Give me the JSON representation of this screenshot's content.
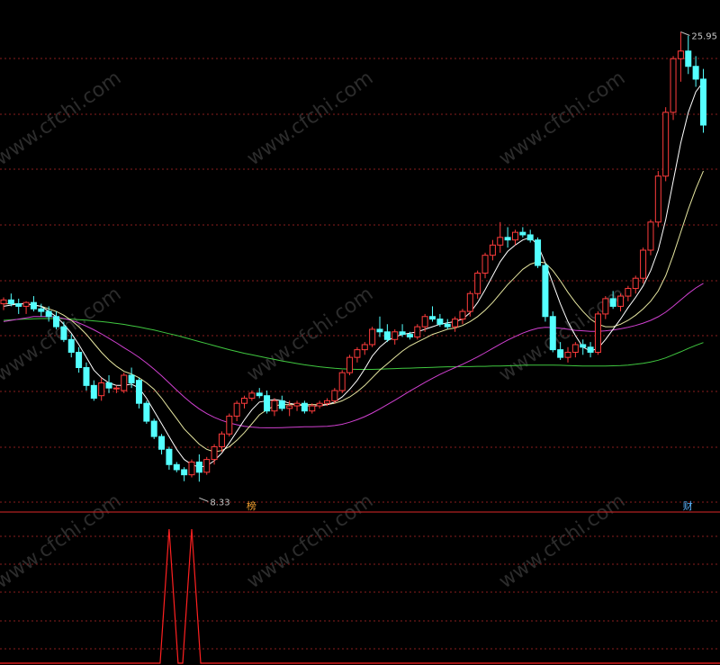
{
  "chart_data": {
    "type": "candlestick",
    "panels": 2,
    "ylim": [
      7.6,
      27.2
    ],
    "grid": true,
    "max_label": "25.95",
    "min_label": "8.33",
    "max_value": 25.95,
    "min_value": 8.33,
    "signal_markers": [
      {
        "label": "榜",
        "bar_index": 33,
        "color": "#f0a030"
      },
      {
        "label": "财",
        "bar_index": 91,
        "color": "#5ab4ff"
      }
    ],
    "watermark_text": "www.cfchi.com",
    "colors": {
      "up": "#ff3c3c",
      "down": "#54ffff",
      "ma_short": "#ffffff",
      "ma_mid": "#e6e6a0",
      "ma_long": "#d040d0",
      "ma_longest": "#40c840",
      "grid": "#8a1e1e",
      "signal": "#ff2020"
    },
    "candles": [
      [
        15.3,
        15.55,
        15.05,
        15.45
      ],
      [
        15.45,
        15.7,
        15.2,
        15.3
      ],
      [
        15.3,
        15.5,
        14.9,
        15.2
      ],
      [
        15.2,
        15.4,
        14.9,
        15.35
      ],
      [
        15.35,
        15.6,
        15.0,
        15.1
      ],
      [
        15.1,
        15.3,
        14.8,
        15.0
      ],
      [
        15.0,
        15.2,
        14.6,
        14.8
      ],
      [
        14.8,
        15.0,
        14.3,
        14.4
      ],
      [
        14.4,
        14.6,
        13.8,
        13.9
      ],
      [
        13.9,
        14.1,
        13.2,
        13.4
      ],
      [
        13.4,
        13.6,
        12.6,
        12.8
      ],
      [
        12.8,
        13.0,
        11.9,
        12.1
      ],
      [
        12.1,
        12.3,
        11.5,
        11.6
      ],
      [
        11.7,
        12.4,
        11.5,
        12.2
      ],
      [
        12.2,
        12.5,
        11.8,
        12.0
      ],
      [
        12.0,
        12.1,
        11.8,
        12.0
      ],
      [
        11.9,
        12.6,
        11.8,
        12.5
      ],
      [
        12.5,
        12.8,
        12.0,
        12.2
      ],
      [
        12.3,
        12.4,
        11.2,
        11.4
      ],
      [
        11.4,
        11.5,
        10.6,
        10.7
      ],
      [
        10.7,
        10.8,
        10.0,
        10.1
      ],
      [
        10.1,
        10.2,
        9.4,
        9.6
      ],
      [
        9.6,
        9.7,
        8.8,
        9.0
      ],
      [
        9.0,
        9.1,
        8.7,
        8.8
      ],
      [
        8.8,
        8.9,
        8.35,
        8.6
      ],
      [
        8.6,
        9.2,
        8.5,
        9.1
      ],
      [
        9.1,
        9.4,
        8.33,
        8.7
      ],
      [
        8.7,
        9.3,
        8.6,
        9.2
      ],
      [
        9.2,
        9.8,
        9.0,
        9.7
      ],
      [
        9.7,
        10.3,
        9.5,
        10.2
      ],
      [
        10.2,
        11.0,
        10.1,
        10.9
      ],
      [
        10.9,
        11.5,
        10.7,
        11.4
      ],
      [
        11.4,
        11.7,
        11.2,
        11.6
      ],
      [
        11.6,
        11.9,
        11.5,
        11.8
      ],
      [
        11.8,
        12.0,
        11.6,
        11.7
      ],
      [
        11.7,
        11.9,
        11.0,
        11.1
      ],
      [
        11.1,
        11.6,
        10.9,
        11.5
      ],
      [
        11.5,
        11.7,
        11.1,
        11.2
      ],
      [
        11.2,
        11.5,
        10.9,
        11.3
      ],
      [
        11.3,
        11.5,
        11.1,
        11.4
      ],
      [
        11.4,
        11.5,
        11.0,
        11.1
      ],
      [
        11.1,
        11.4,
        11.0,
        11.3
      ],
      [
        11.3,
        11.5,
        11.2,
        11.4
      ],
      [
        11.4,
        11.6,
        11.3,
        11.5
      ],
      [
        11.5,
        12.0,
        11.4,
        11.9
      ],
      [
        11.9,
        12.7,
        11.8,
        12.6
      ],
      [
        12.6,
        13.3,
        12.5,
        13.2
      ],
      [
        13.2,
        13.6,
        13.0,
        13.5
      ],
      [
        13.5,
        13.8,
        13.3,
        13.7
      ],
      [
        13.7,
        14.4,
        13.6,
        14.3
      ],
      [
        14.3,
        14.8,
        14.0,
        14.2
      ],
      [
        14.2,
        14.5,
        13.8,
        13.9
      ],
      [
        13.9,
        14.3,
        13.7,
        14.2
      ],
      [
        14.2,
        14.5,
        14.0,
        14.1
      ],
      [
        14.1,
        14.2,
        13.9,
        14.0
      ],
      [
        14.0,
        14.5,
        13.9,
        14.4
      ],
      [
        14.4,
        14.9,
        14.2,
        14.8
      ],
      [
        14.8,
        15.2,
        14.6,
        14.7
      ],
      [
        14.7,
        14.9,
        14.4,
        14.5
      ],
      [
        14.5,
        14.7,
        14.3,
        14.4
      ],
      [
        14.4,
        14.8,
        14.2,
        14.7
      ],
      [
        14.7,
        15.1,
        14.5,
        15.0
      ],
      [
        15.0,
        15.8,
        14.8,
        15.7
      ],
      [
        15.7,
        16.6,
        15.5,
        16.5
      ],
      [
        16.5,
        17.3,
        16.3,
        17.2
      ],
      [
        17.2,
        17.8,
        17.0,
        17.6
      ],
      [
        17.6,
        18.5,
        17.3,
        17.9
      ],
      [
        17.9,
        18.3,
        17.5,
        17.8
      ],
      [
        17.8,
        18.2,
        17.6,
        18.1
      ],
      [
        18.1,
        18.3,
        17.9,
        18.0
      ],
      [
        18.0,
        18.2,
        17.7,
        17.8
      ],
      [
        17.8,
        17.9,
        16.7,
        16.8
      ],
      [
        16.8,
        16.9,
        14.6,
        14.8
      ],
      [
        14.8,
        15.0,
        13.4,
        13.5
      ],
      [
        13.5,
        13.8,
        13.1,
        13.2
      ],
      [
        13.2,
        13.6,
        13.0,
        13.4
      ],
      [
        13.4,
        13.8,
        13.2,
        13.7
      ],
      [
        13.7,
        13.9,
        13.3,
        13.6
      ],
      [
        13.6,
        13.8,
        13.2,
        13.4
      ],
      [
        13.4,
        15.0,
        13.3,
        14.9
      ],
      [
        14.9,
        15.6,
        14.7,
        15.5
      ],
      [
        15.5,
        15.8,
        15.1,
        15.2
      ],
      [
        15.2,
        15.7,
        15.0,
        15.6
      ],
      [
        15.6,
        16.0,
        15.4,
        15.9
      ],
      [
        15.9,
        16.4,
        15.7,
        16.3
      ],
      [
        16.3,
        17.5,
        16.1,
        17.4
      ],
      [
        17.4,
        18.6,
        17.2,
        18.5
      ],
      [
        18.5,
        20.5,
        18.3,
        20.3
      ],
      [
        20.3,
        23.0,
        20.1,
        22.8
      ],
      [
        22.8,
        25.0,
        22.5,
        24.9
      ],
      [
        24.9,
        25.95,
        24.0,
        25.2
      ],
      [
        25.2,
        25.8,
        24.3,
        24.6
      ],
      [
        24.6,
        25.0,
        23.8,
        24.1
      ],
      [
        24.1,
        24.5,
        22.0,
        22.3
      ]
    ],
    "ma_short": [
      15.2,
      15.25,
      15.3,
      15.3,
      15.25,
      15.2,
      15.0,
      14.8,
      14.5,
      14.15,
      13.7,
      13.2,
      12.7,
      12.4,
      12.2,
      12.1,
      12.1,
      12.15,
      12.0,
      11.6,
      11.1,
      10.6,
      10.1,
      9.6,
      9.2,
      9.0,
      8.9,
      8.95,
      9.15,
      9.45,
      9.85,
      10.3,
      10.75,
      11.15,
      11.45,
      11.5,
      11.55,
      11.5,
      11.4,
      11.35,
      11.3,
      11.3,
      11.3,
      11.35,
      11.45,
      11.65,
      11.95,
      12.3,
      12.75,
      13.25,
      13.6,
      13.85,
      14.0,
      14.1,
      14.15,
      14.2,
      14.3,
      14.4,
      14.5,
      14.55,
      14.6,
      14.7,
      14.95,
      15.35,
      15.85,
      16.4,
      16.95,
      17.35,
      17.6,
      17.8,
      17.9,
      17.6,
      16.9,
      16.1,
      15.3,
      14.6,
      14.05,
      13.6,
      13.45,
      13.55,
      13.9,
      14.3,
      14.7,
      15.15,
      15.55,
      16.0,
      16.6,
      17.4,
      18.6,
      20.1,
      21.6,
      22.8,
      23.6,
      24.0
    ],
    "ma_mid": [
      15.3,
      15.3,
      15.3,
      15.3,
      15.25,
      15.2,
      15.1,
      15.0,
      14.85,
      14.65,
      14.4,
      14.1,
      13.75,
      13.4,
      13.1,
      12.85,
      12.65,
      12.55,
      12.4,
      12.2,
      11.95,
      11.6,
      11.2,
      10.8,
      10.4,
      10.1,
      9.8,
      9.6,
      9.5,
      9.55,
      9.7,
      9.95,
      10.25,
      10.6,
      10.95,
      11.15,
      11.3,
      11.35,
      11.35,
      11.35,
      11.35,
      11.35,
      11.35,
      11.35,
      11.4,
      11.5,
      11.65,
      11.85,
      12.1,
      12.4,
      12.7,
      12.95,
      13.2,
      13.45,
      13.65,
      13.8,
      13.95,
      14.1,
      14.2,
      14.3,
      14.35,
      14.45,
      14.6,
      14.8,
      15.05,
      15.35,
      15.7,
      16.05,
      16.35,
      16.65,
      16.85,
      16.95,
      16.9,
      16.6,
      16.2,
      15.75,
      15.35,
      15.0,
      14.7,
      14.5,
      14.4,
      14.4,
      14.5,
      14.65,
      14.85,
      15.1,
      15.4,
      15.8,
      16.4,
      17.2,
      18.1,
      19.0,
      19.8,
      20.5
    ],
    "ma_long": [
      14.6,
      14.65,
      14.7,
      14.75,
      14.8,
      14.8,
      14.8,
      14.78,
      14.72,
      14.65,
      14.55,
      14.42,
      14.28,
      14.12,
      13.95,
      13.77,
      13.58,
      13.4,
      13.2,
      12.98,
      12.74,
      12.48,
      12.2,
      11.92,
      11.65,
      11.4,
      11.18,
      11.0,
      10.85,
      10.73,
      10.63,
      10.56,
      10.5,
      10.47,
      10.45,
      10.44,
      10.44,
      10.45,
      10.46,
      10.47,
      10.48,
      10.48,
      10.49,
      10.5,
      10.53,
      10.58,
      10.66,
      10.76,
      10.88,
      11.02,
      11.18,
      11.35,
      11.52,
      11.7,
      11.88,
      12.05,
      12.22,
      12.38,
      12.53,
      12.67,
      12.8,
      12.93,
      13.07,
      13.22,
      13.38,
      13.55,
      13.72,
      13.88,
      14.02,
      14.15,
      14.26,
      14.34,
      14.38,
      14.37,
      14.34,
      14.3,
      14.26,
      14.24,
      14.22,
      14.22,
      14.24,
      14.27,
      14.32,
      14.38,
      14.45,
      14.54,
      14.65,
      14.79,
      14.97,
      15.2,
      15.45,
      15.7,
      15.92,
      16.1
    ],
    "ma_longest": [
      14.65,
      14.67,
      14.69,
      14.7,
      14.71,
      14.72,
      14.72,
      14.72,
      14.71,
      14.7,
      14.68,
      14.66,
      14.63,
      14.6,
      14.57,
      14.53,
      14.49,
      14.44,
      14.39,
      14.33,
      14.27,
      14.2,
      14.13,
      14.06,
      13.98,
      13.9,
      13.82,
      13.74,
      13.66,
      13.58,
      13.5,
      13.43,
      13.36,
      13.3,
      13.24,
      13.18,
      13.12,
      13.06,
      13.01,
      12.96,
      12.91,
      12.87,
      12.83,
      12.8,
      12.77,
      12.75,
      12.74,
      12.73,
      12.73,
      12.73,
      12.74,
      12.75,
      12.76,
      12.77,
      12.78,
      12.79,
      12.8,
      12.81,
      12.82,
      12.83,
      12.83,
      12.84,
      12.84,
      12.85,
      12.85,
      12.86,
      12.86,
      12.87,
      12.88,
      12.89,
      12.9,
      12.9,
      12.9,
      12.9,
      12.89,
      12.88,
      12.87,
      12.86,
      12.86,
      12.86,
      12.86,
      12.87,
      12.88,
      12.9,
      12.93,
      12.97,
      13.02,
      13.09,
      13.18,
      13.3,
      13.42,
      13.55,
      13.67,
      13.78
    ],
    "indicator": {
      "type": "signal",
      "spike_bars": [
        22,
        25
      ],
      "values": []
    }
  }
}
